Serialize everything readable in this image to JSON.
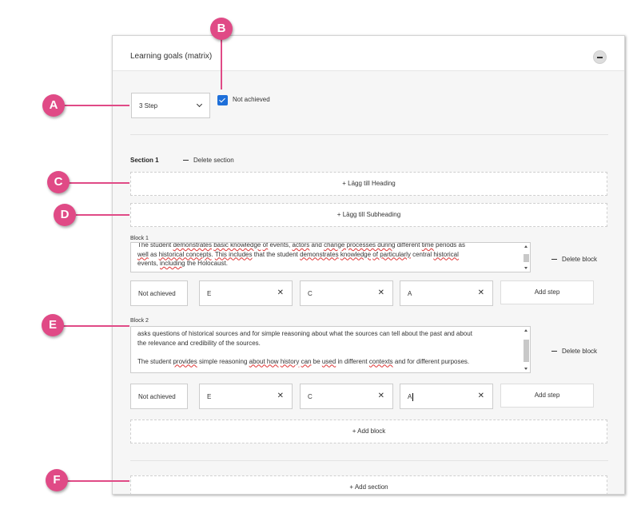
{
  "panel": {
    "title": "Learning goals (matrix)"
  },
  "step_select": {
    "value": "3 Step"
  },
  "not_achieved_checkbox": {
    "label": "Not achieved",
    "checked": true
  },
  "section": {
    "label": "Section 1",
    "delete_label": "Delete section",
    "add_heading_label": "+ Lägg till Heading",
    "add_subheading_label": "+ Lägg till Subheading",
    "blocks": [
      {
        "label": "Block 1",
        "delete_label": "Delete block",
        "steps": [
          "Not achieved",
          "E",
          "C",
          "A"
        ],
        "add_step_label": "Add step"
      },
      {
        "label": "Block 2",
        "text_line1": "asks questions of historical sources and for simple reasoning about what the sources can tell about the past and about",
        "text_line2": "the relevance and credibility of the sources.",
        "delete_label": "Delete block",
        "steps": [
          "Not achieved",
          "E",
          "C",
          "A"
        ],
        "add_step_label": "Add step"
      }
    ],
    "add_block_label": "+ Add block"
  },
  "add_section_label": "+ Add section",
  "callouts": [
    "A",
    "B",
    "C",
    "D",
    "E",
    "F"
  ],
  "colors": {
    "accent": "#e04a86",
    "checkbox": "#1e6fd9"
  }
}
